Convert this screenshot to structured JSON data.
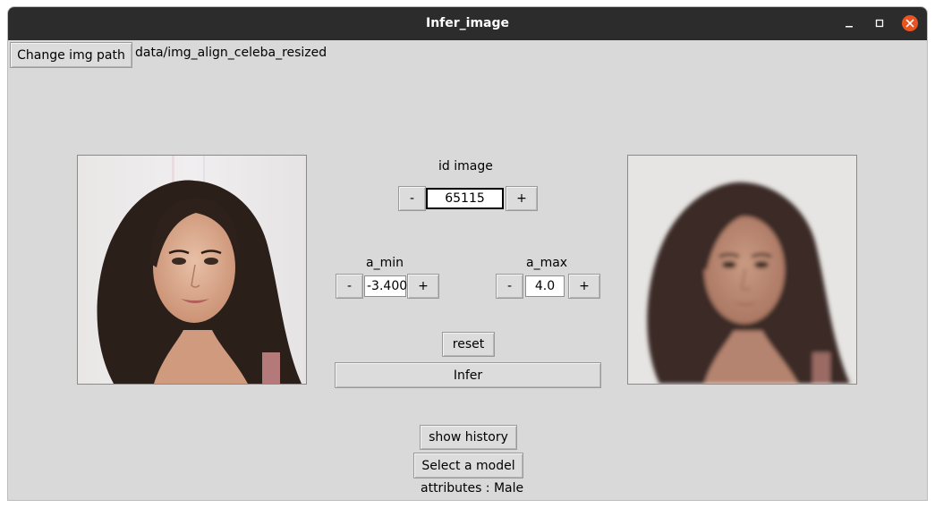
{
  "window": {
    "title": "Infer_image"
  },
  "toolbar": {
    "change_path_label": "Change img path",
    "img_path": "data/img_align_celeba_resized"
  },
  "id_image": {
    "label": "id image",
    "value": "65115",
    "decrement": "-",
    "increment": "+"
  },
  "a_min": {
    "label": "a_min",
    "value": "-3.400",
    "decrement": "-",
    "increment": "+"
  },
  "a_max": {
    "label": "a_max",
    "value": "4.0",
    "decrement": "-",
    "increment": "+"
  },
  "actions": {
    "reset_label": "reset",
    "infer_label": "Infer",
    "show_history_label": "show history",
    "select_model_label": "Select a model"
  },
  "status": {
    "attributes_text": "attributes : Male"
  },
  "icons": {
    "minimize": "minimize-icon",
    "maximize": "maximize-icon",
    "close": "close-icon"
  },
  "colors": {
    "titlebar": "#2c2c2c",
    "close_button": "#e95420",
    "window_bg": "#d9d9d9"
  }
}
